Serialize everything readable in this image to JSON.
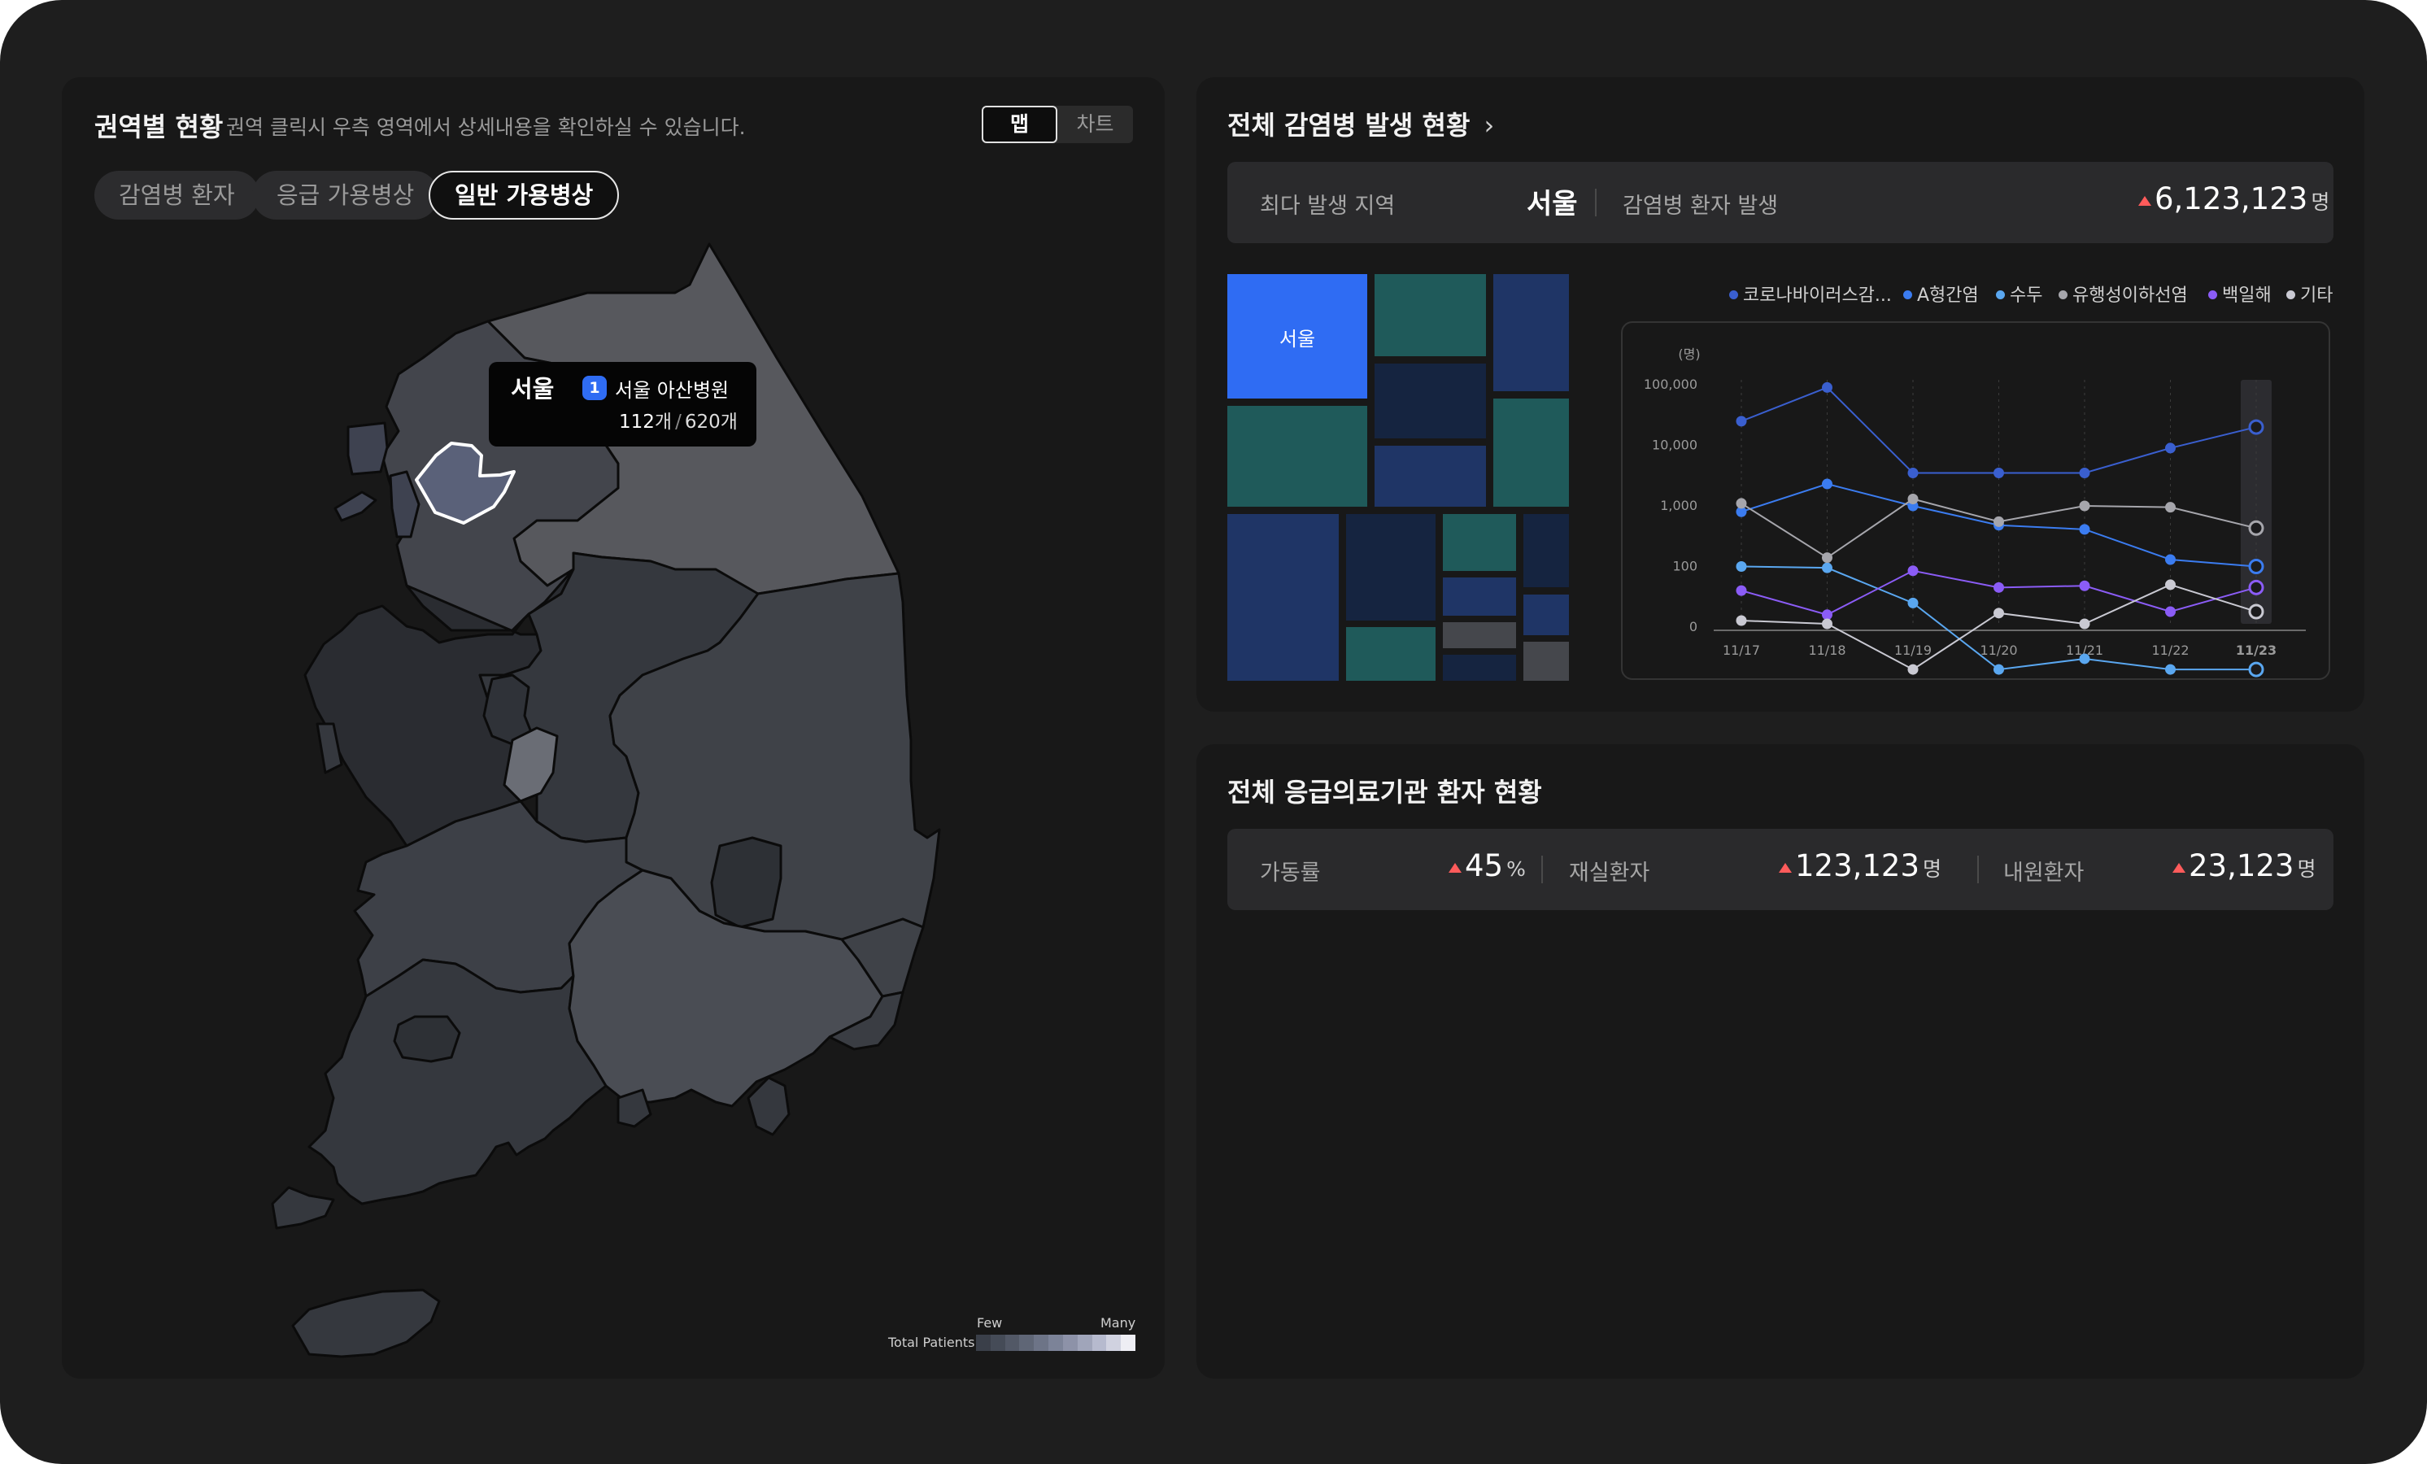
{
  "left_panel": {
    "title": "권역별 현황",
    "subtitle": "권역 클릭시 우측 영역에서 상세내용을 확인하실 수 있습니다.",
    "view_toggle": {
      "map": "맵",
      "chart": "차트",
      "selected": "맵"
    },
    "tabs": [
      "감염병 환자",
      "응급 가용병상",
      "일반 가용병상"
    ],
    "active_tab": "일반 가용병상",
    "tooltip": {
      "region": "서울",
      "rank": "1",
      "hospital": "서울 아산병원",
      "count": "112",
      "count_unit": "개",
      "total": "620개"
    },
    "legend": {
      "few": "Few",
      "many": "Many",
      "label": "Total Patients",
      "colors": [
        "#3a3f49",
        "#454b57",
        "#525866",
        "#5f6676",
        "#6d7487",
        "#7c8398",
        "#8d92a8",
        "#a0a5ba",
        "#b6bace",
        "#d0d2e0",
        "#eeeef4"
      ]
    }
  },
  "infection_panel": {
    "title": "전체 감염병 발생 현황",
    "top_region_label": "최다 발생 지역",
    "top_region": "서울",
    "patients_label": "감염병 환자 발생",
    "patients_value": "6,123,123",
    "patients_unit": "명",
    "treemap_label": "서울",
    "colors": {
      "blue": "#2f6cf3",
      "teal": "#1f5a5a",
      "navy": "#1f3566",
      "dark_navy": "#152440",
      "gray": "#45474c"
    }
  },
  "chart_data": {
    "type": "line",
    "ylabel": "(명)",
    "y_scale": "log",
    "y_ticks": [
      "100,000",
      "10,000",
      "1,000",
      "100",
      "0"
    ],
    "x": [
      "11/17",
      "11/18",
      "11/19",
      "11/20",
      "11/21",
      "11/22",
      "11/23"
    ],
    "highlight_x": "11/23",
    "legend_position": "top-right",
    "series": [
      {
        "name": "코로나바이러스감...",
        "color": "#3a5fcf",
        "values": [
          25000,
          90000,
          3500,
          3500,
          3500,
          9000,
          20000
        ]
      },
      {
        "name": "A형간염",
        "color": "#3b7cf0",
        "values": [
          800,
          2300,
          1000,
          480,
          410,
          130,
          100
        ]
      },
      {
        "name": "수두",
        "color": "#5aa7f0",
        "values": [
          100,
          95,
          25,
          2,
          3,
          2,
          2
        ]
      },
      {
        "name": "유행성이하선염",
        "color": "#a6a6ac",
        "values": [
          1100,
          140,
          1300,
          550,
          1000,
          950,
          430
        ]
      },
      {
        "name": "백일해",
        "color": "#8b5cf6",
        "values": [
          40,
          16,
          85,
          45,
          48,
          18,
          45
        ]
      },
      {
        "name": "기타",
        "color": "#c9c9d2",
        "values": [
          1,
          0.5,
          2,
          17,
          0.5,
          50,
          18
        ]
      }
    ]
  },
  "emergency_panel": {
    "title": "전체 응급의료기관 환자 현황",
    "rate_label": "가동률",
    "rate_value": "45",
    "rate_unit": "%",
    "inpatient_label": "재실환자",
    "inpatient_value": "123,123",
    "inpatient_unit": "명",
    "visitor_label": "내원환자",
    "visitor_value": "23,123",
    "visitor_unit": "명"
  }
}
